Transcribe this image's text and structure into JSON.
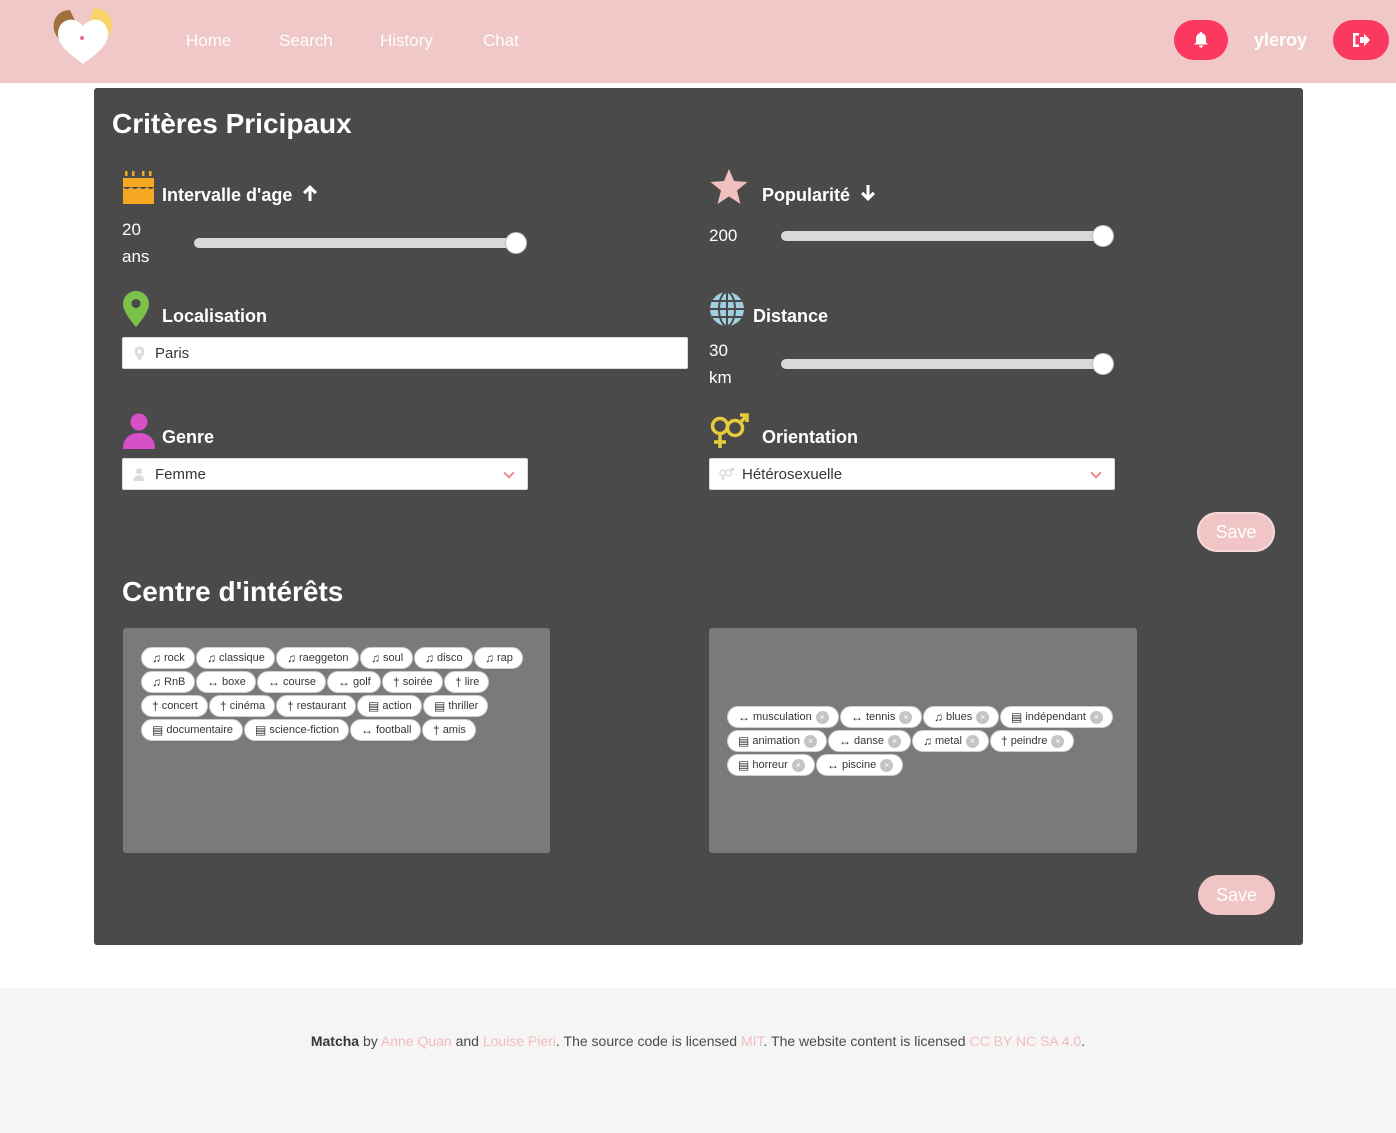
{
  "nav": {
    "links": [
      "Home",
      "Search",
      "History",
      "Chat"
    ],
    "username": "yleroy"
  },
  "criteria": {
    "title": "Critères Pricipaux",
    "age": {
      "label": "Intervalle d'age",
      "value": "20",
      "unit": "ans",
      "level": 1.0
    },
    "popularity": {
      "label": "Popularité",
      "value": "200",
      "level": 1.0
    },
    "location": {
      "label": "Localisation",
      "value": "Paris"
    },
    "distance": {
      "label": "Distance",
      "value": "30",
      "unit": "km",
      "level": 1.0
    },
    "gender": {
      "label": "Genre",
      "selected": "Femme"
    },
    "orientation": {
      "label": "Orientation",
      "selected": "Hétérosexuelle"
    },
    "save_label": "Save"
  },
  "interests": {
    "title": "Centre d'intérêts",
    "available": [
      {
        "icon": "music-icon",
        "label": "rock"
      },
      {
        "icon": "music-icon",
        "label": "classique"
      },
      {
        "icon": "music-icon",
        "label": "raeggeton"
      },
      {
        "icon": "music-icon",
        "label": "soul"
      },
      {
        "icon": "music-icon",
        "label": "disco"
      },
      {
        "icon": "music-icon",
        "label": "rap"
      },
      {
        "icon": "music-icon",
        "label": "RnB"
      },
      {
        "icon": "dumbbell-icon",
        "label": "boxe"
      },
      {
        "icon": "dumbbell-icon",
        "label": "course"
      },
      {
        "icon": "dumbbell-icon",
        "label": "golf"
      },
      {
        "icon": "cocktail-icon",
        "label": "soirée"
      },
      {
        "icon": "cocktail-icon",
        "label": "lire"
      },
      {
        "icon": "cocktail-icon",
        "label": "concert"
      },
      {
        "icon": "cocktail-icon",
        "label": "cinéma"
      },
      {
        "icon": "cocktail-icon",
        "label": "restaurant"
      },
      {
        "icon": "film-icon",
        "label": "action"
      },
      {
        "icon": "film-icon",
        "label": "thriller"
      },
      {
        "icon": "film-icon",
        "label": "documentaire"
      },
      {
        "icon": "film-icon",
        "label": "science-fiction"
      },
      {
        "icon": "dumbbell-icon",
        "label": "football"
      },
      {
        "icon": "cocktail-icon",
        "label": "amis"
      }
    ],
    "selected": [
      {
        "icon": "dumbbell-icon",
        "label": "musculation"
      },
      {
        "icon": "dumbbell-icon",
        "label": "tennis"
      },
      {
        "icon": "music-icon",
        "label": "blues"
      },
      {
        "icon": "film-icon",
        "label": "indépendant"
      },
      {
        "icon": "film-icon",
        "label": "animation"
      },
      {
        "icon": "dumbbell-icon",
        "label": "danse"
      },
      {
        "icon": "music-icon",
        "label": "metal"
      },
      {
        "icon": "cocktail-icon",
        "label": "peindre"
      },
      {
        "icon": "film-icon",
        "label": "horreur"
      },
      {
        "icon": "dumbbell-icon",
        "label": "piscine"
      }
    ],
    "save_label": "Save"
  },
  "footer": {
    "brand": "Matcha",
    "by": " by ",
    "author1": "Anne Quan",
    "and": " and ",
    "author2": "Louise Pieri",
    "source_text": ". The source code is licensed ",
    "license1": "MIT",
    "content_text": ". The website content is licensed ",
    "license2": "CC BY NC SA 4.0",
    "end": "."
  },
  "colors": {
    "navbar": "#f0c8c8",
    "accent_button": "#fb385f",
    "card": "#4a4a4a",
    "tag_box": "#7a7a7a",
    "save_button": "#f1c5c5",
    "cake_icon": "#f7a823",
    "star_icon": "#f2bfbf",
    "pin_icon": "#7cc24a",
    "globe_icon": "#9fcfe0",
    "person_icon": "#d94fc8",
    "gender_icon": "#e6cc3a"
  }
}
